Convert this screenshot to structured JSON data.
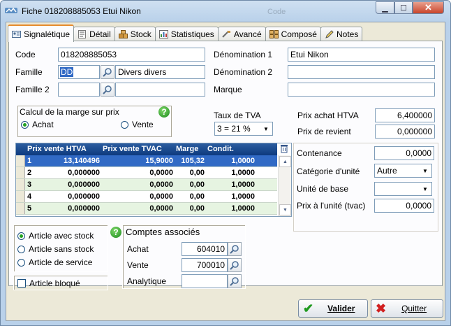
{
  "window": {
    "title": "Fiche 018208885053 Etui Nikon",
    "background_title": "Code",
    "min_glyph": "▁",
    "max_glyph": "☐",
    "close_glyph": "✕"
  },
  "tabs": [
    {
      "label": "Signalétique",
      "icon": "id-card-icon",
      "active": true
    },
    {
      "label": "Détail",
      "icon": "document-icon"
    },
    {
      "label": "Stock",
      "icon": "boxes-icon"
    },
    {
      "label": "Statistiques",
      "icon": "chart-icon"
    },
    {
      "label": "Avancé",
      "icon": "tools-icon"
    },
    {
      "label": "Composé",
      "icon": "composite-icon"
    },
    {
      "label": "Notes",
      "icon": "pencil-icon"
    }
  ],
  "identity": {
    "code_label": "Code",
    "code_value": "018208885053",
    "famille_label": "Famille",
    "famille_code": "DD",
    "famille_name": "Divers divers",
    "famille2_label": "Famille 2",
    "famille2_code": "",
    "famille2_name": "",
    "denomination1_label": "Dénomination 1",
    "denomination1_value": "Etui Nikon",
    "denomination2_label": "Dénomination 2",
    "denomination2_value": "",
    "marque_label": "Marque",
    "marque_value": ""
  },
  "marge": {
    "title": "Calcul de la marge sur prix",
    "help": "?",
    "options": [
      {
        "label": "Achat",
        "checked": true
      },
      {
        "label": "Vente",
        "checked": false
      }
    ]
  },
  "tva": {
    "label": "Taux de TVA",
    "value": "3 = 21 %",
    "arrow": "▼"
  },
  "prix": {
    "achat_label": "Prix achat HTVA",
    "achat_value": "6,400000",
    "revient_label": "Prix de revient",
    "revient_value": "0,000000"
  },
  "grid": {
    "columns": [
      "Prix vente HTVA",
      "Prix vente TVAC",
      "Marge",
      "Condit."
    ],
    "rows": [
      {
        "n": "1",
        "htva": "13,140496",
        "tvac": "15,9000",
        "marge": "105,32",
        "condit": "1,0000",
        "selected": true
      },
      {
        "n": "2",
        "htva": "0,000000",
        "tvac": "0,0000",
        "marge": "0,00",
        "condit": "1,0000"
      },
      {
        "n": "3",
        "htva": "0,000000",
        "tvac": "0,0000",
        "marge": "0,00",
        "condit": "1,0000"
      },
      {
        "n": "4",
        "htva": "0,000000",
        "tvac": "0,0000",
        "marge": "0,00",
        "condit": "1,0000"
      },
      {
        "n": "5",
        "htva": "0,000000",
        "tvac": "0,0000",
        "marge": "0,00",
        "condit": "1,0000"
      }
    ],
    "scroll_up": "▲",
    "scroll_down": "▼"
  },
  "unit": {
    "contenance_label": "Contenance",
    "contenance_value": "0,0000",
    "categorie_label": "Catégorie d'unité",
    "categorie_value": "Autre",
    "base_label": "Unité de base",
    "base_value": "",
    "prix_label": "Prix à l'unité (tvac)",
    "prix_value": "0,0000",
    "arrow": "▼"
  },
  "article_type": {
    "options": [
      {
        "label": "Article avec stock",
        "checked": true
      },
      {
        "label": "Article sans stock",
        "checked": false
      },
      {
        "label": "Article de service",
        "checked": false
      }
    ],
    "bloque_label": "Article bloqué",
    "help": "?"
  },
  "comptes": {
    "title": "Comptes associés",
    "achat_label": "Achat",
    "achat_value": "604010",
    "vente_label": "Vente",
    "vente_value": "700010",
    "analytique_label": "Analytique",
    "analytique_value": ""
  },
  "buttons": {
    "valider": "Valider",
    "valider_glyph": "✔",
    "quitter": "Quitter",
    "quitter_glyph": "✖"
  },
  "colors": {
    "selection": "#316ac5",
    "row_green": "#e6f4e1",
    "grid_header": "#0d3a7e",
    "help_green": "#1b8a1b"
  }
}
